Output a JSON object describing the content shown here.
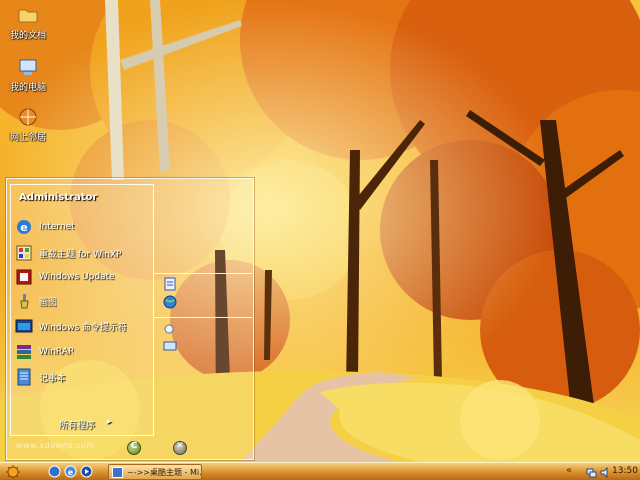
{
  "desktop": {
    "icons": [
      {
        "label": "我的文档",
        "icon": "folder-icon"
      },
      {
        "label": "我的电脑",
        "icon": "computer-icon"
      },
      {
        "label": "网上邻居",
        "icon": "network-icon"
      }
    ]
  },
  "start_menu": {
    "user": "Administrator",
    "programs": [
      {
        "label": "Internet",
        "icon": "internet-explorer-icon"
      },
      {
        "label": "重载主题 for WinXP",
        "icon": "theme-icon"
      },
      {
        "label": "Windows Update",
        "icon": "windows-update-icon"
      },
      {
        "label": "画图",
        "icon": "paint-icon"
      },
      {
        "label": "Windows 命令提示符",
        "icon": "command-prompt-icon"
      },
      {
        "label": "WinRAR",
        "icon": "winrar-icon"
      },
      {
        "label": "记事本",
        "icon": "notepad-icon"
      }
    ],
    "all_programs_label": "所有程序",
    "all_programs_arrow": "▸",
    "right_icons": [
      "documents-icon",
      "globe-icon",
      "search-icon",
      "run-icon"
    ],
    "logoff_glyph": "C",
    "shutdown_glyph": "✕"
  },
  "watermark": "www.xdowns.com",
  "taskbar": {
    "task_label": "~->>桌酷主题 - Mi...",
    "tray_chevron": "«",
    "clock": "13:50"
  },
  "colors": {
    "taskbar_top": "#f4cf7f",
    "taskbar_bottom": "#b86b15",
    "menu_border": "#ffffff"
  }
}
